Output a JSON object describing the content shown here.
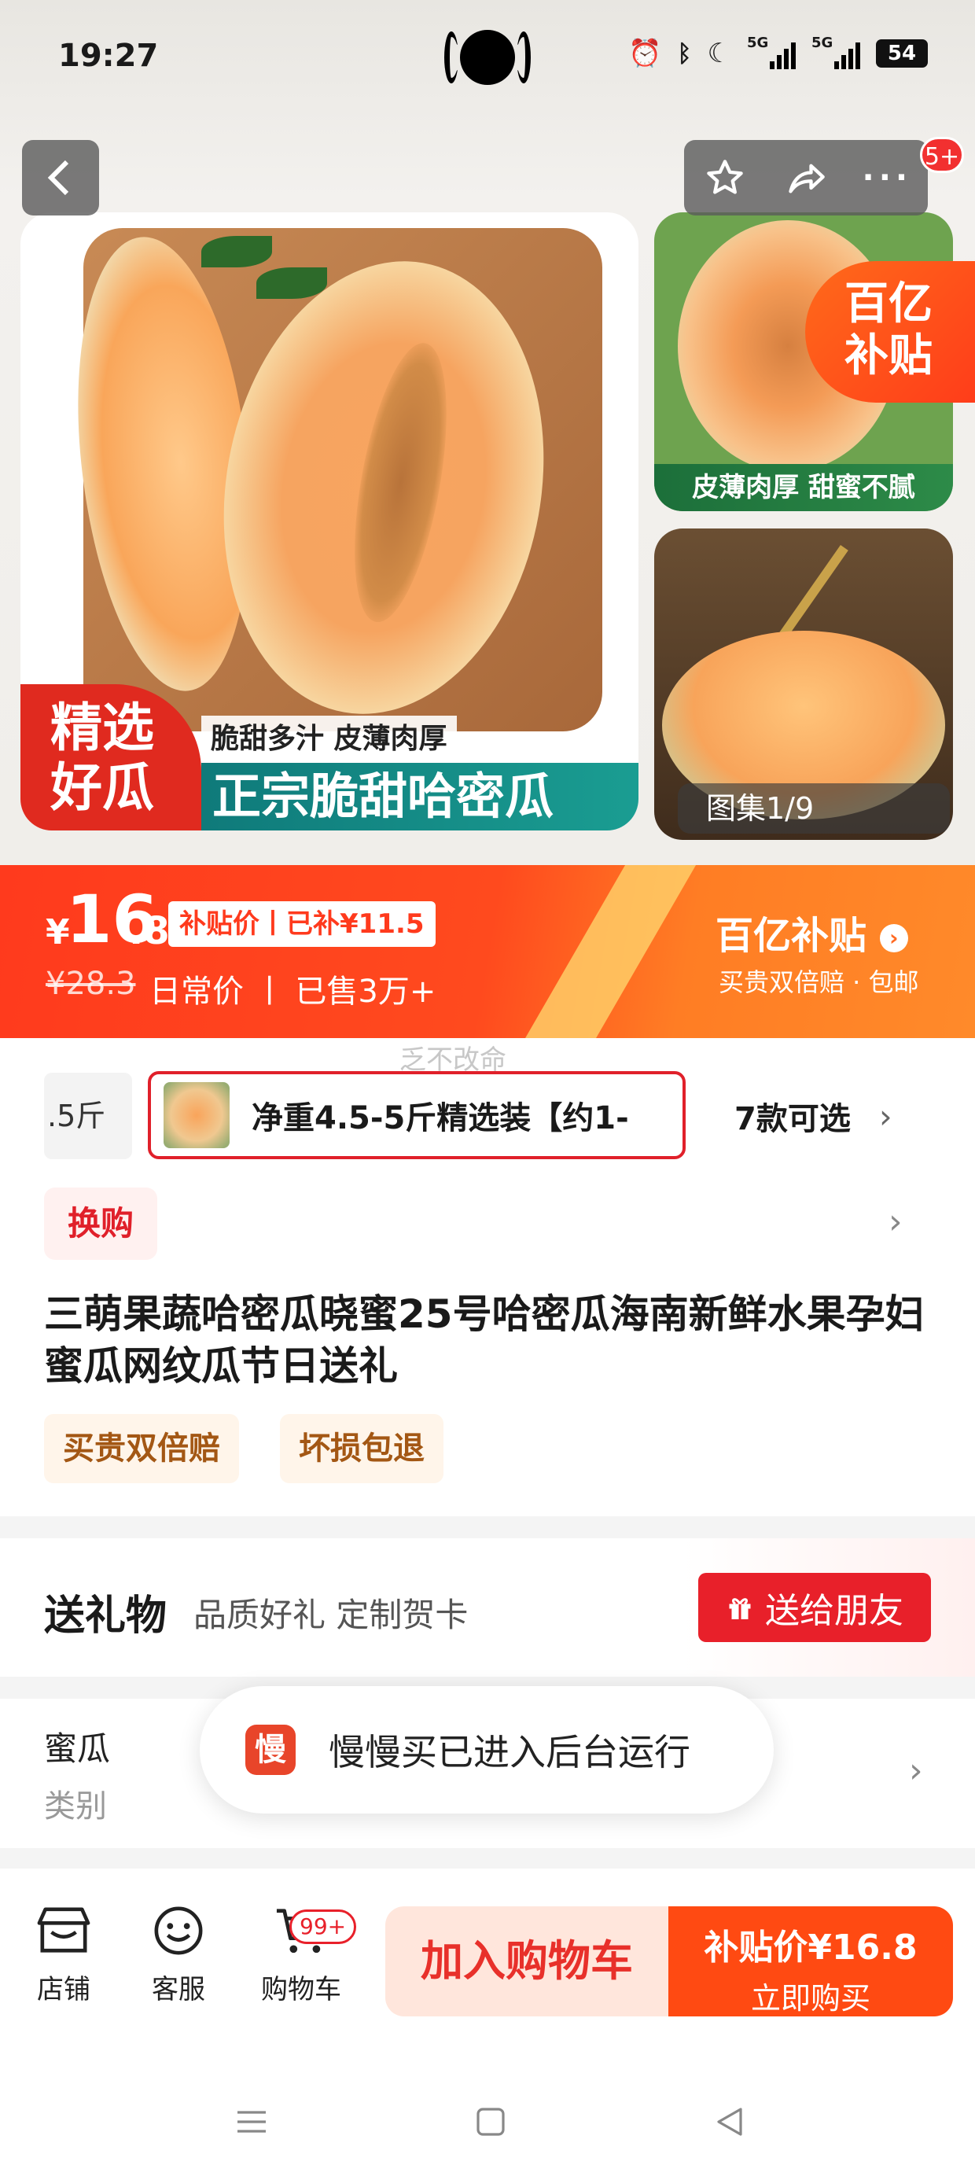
{
  "status_bar": {
    "time": "19:27",
    "battery": "54",
    "network_label": "5G"
  },
  "gallery": {
    "main_tag": [
      "精选",
      "好瓜"
    ],
    "main_subtitle": "脆甜多汁  皮薄肉厚",
    "main_band": "正宗脆甜哈密瓜",
    "side1_caption": "皮薄肉厚 甜蜜不腻",
    "subsidy_badge": [
      "百亿",
      "补贴"
    ],
    "counter": "图集1/9",
    "notification_count": "5+"
  },
  "price": {
    "currency": "¥",
    "integer": "16",
    "decimal": ".8",
    "pill": "补贴价丨已补¥11.5",
    "original": "¥28.3",
    "info": "日常价 丨 已售3万+",
    "program": "百亿补贴",
    "program_sub": "买贵双倍赔 · 包邮"
  },
  "watermark": "乏不改命",
  "sku": {
    "prev_label": ".5斤",
    "selected_label": "净重4.5-5斤精选装【约1-",
    "more_label": "7款可选"
  },
  "exchange_label": "换购",
  "product_title": "三萌果蔬哈密瓜晓蜜25号哈密瓜海南新鲜水果孕妇蜜瓜网纹瓜节日送礼",
  "guarantees": [
    "买贵双倍赔",
    "坏损包退"
  ],
  "gift": {
    "title": "送礼物",
    "subtitle": "品质好礼 定制贺卡",
    "button": "送给朋友"
  },
  "spec": [
    {
      "value": "蜜瓜",
      "label": "类别"
    },
    {
      "value": "",
      "label": ""
    },
    {
      "value": "",
      "label": ""
    }
  ],
  "toast": {
    "icon_text": "慢",
    "text": "慢慢买已进入后台运行"
  },
  "bottom": {
    "store": "店铺",
    "service": "客服",
    "cart": "购物车",
    "cart_badge": "99+",
    "add_to_cart": "加入购物车",
    "buy_price": "补贴价¥16.8",
    "buy_now": "立即购买"
  },
  "colors": {
    "accent": "#ff4a12",
    "red": "#e8202a",
    "subsidy_orange": "#ff7d24"
  }
}
